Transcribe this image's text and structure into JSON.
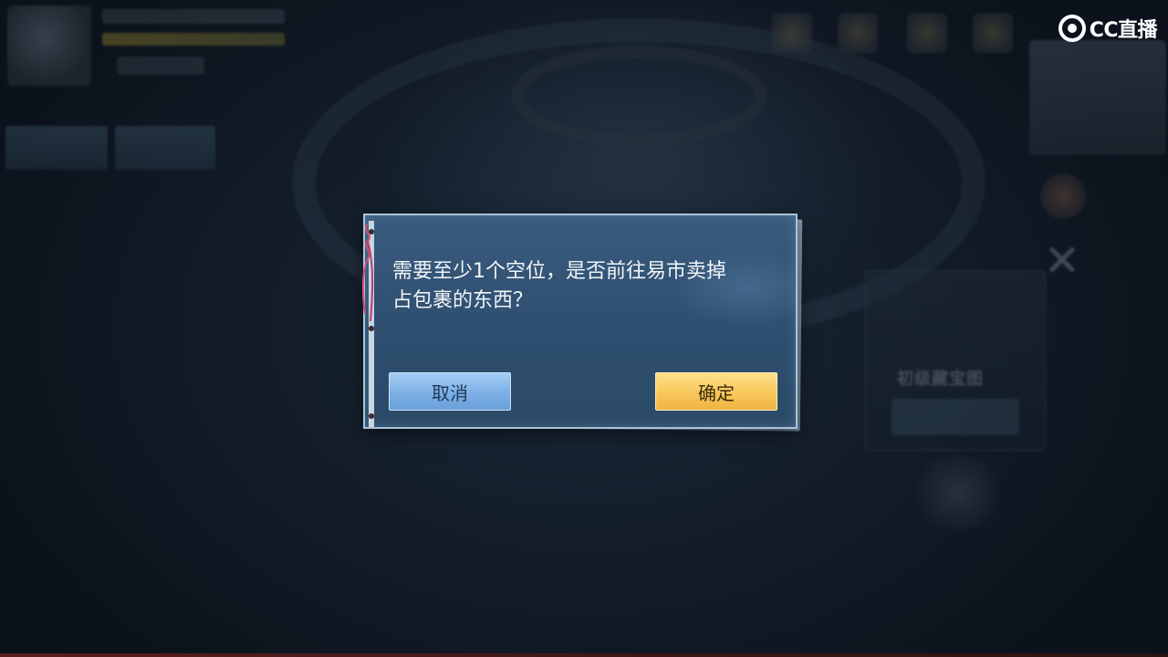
{
  "dialog": {
    "message_line1": "需要至少1个空位，是否前往易市卖掉",
    "message_line2": "占包裹的东西？",
    "cancel_label": "取消",
    "confirm_label": "确定"
  },
  "background": {
    "treasure_label": "初级藏宝图"
  },
  "watermark": {
    "text": "CC直播"
  },
  "colors": {
    "dialog_bg": "#2f4f70",
    "cancel_button": "#7db0e6",
    "confirm_button": "#f8c75a"
  }
}
